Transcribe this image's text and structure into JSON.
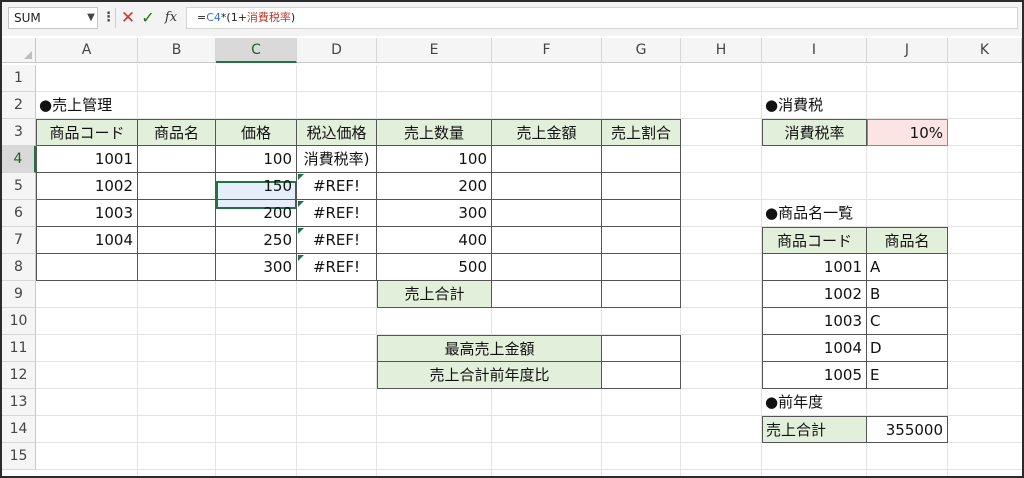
{
  "formula_bar": {
    "name_box": "SUM",
    "formula_prefix": "=",
    "formula_ref": "C4",
    "formula_mid": "*(1+",
    "formula_name": "消費税率",
    "formula_suffix": ")"
  },
  "columns": [
    "A",
    "B",
    "C",
    "D",
    "E",
    "F",
    "G",
    "H",
    "I",
    "J",
    "K"
  ],
  "rows": [
    "1",
    "2",
    "3",
    "4",
    "5",
    "6",
    "7",
    "8",
    "9",
    "10",
    "11",
    "12",
    "13",
    "14",
    "15"
  ],
  "sales": {
    "title": "●売上管理",
    "headers": [
      "商品コード",
      "商品名",
      "価格",
      "税込価格",
      "売上数量",
      "売上金額",
      "売上割合"
    ],
    "rows": [
      {
        "code": "1001",
        "price": "100",
        "tax_price": "消費税率)",
        "qty": "100"
      },
      {
        "code": "1002",
        "price": "150",
        "tax_price": "#REF!",
        "qty": "200"
      },
      {
        "code": "1003",
        "price": "200",
        "tax_price": "#REF!",
        "qty": "300"
      },
      {
        "code": "1004",
        "price": "250",
        "tax_price": "#REF!",
        "qty": "400"
      },
      {
        "code": "",
        "price": "300",
        "tax_price": "#REF!",
        "qty": "500"
      }
    ],
    "total_label": "売上合計",
    "max_label": "最高売上金額",
    "yoy_label": "売上合計前年度比"
  },
  "tax": {
    "title": "●消費税",
    "label": "消費税率",
    "value": "10%"
  },
  "products": {
    "title": "●商品名一覧",
    "headers": [
      "商品コード",
      "商品名"
    ],
    "rows": [
      {
        "code": "1001",
        "name": "A"
      },
      {
        "code": "1002",
        "name": "B"
      },
      {
        "code": "1003",
        "name": "C"
      },
      {
        "code": "1004",
        "name": "D"
      },
      {
        "code": "1005",
        "name": "E"
      }
    ]
  },
  "prev_year": {
    "title": "●前年度",
    "label": "売上合計",
    "value": "355000"
  },
  "colors": {
    "header_fill": "#e2efda",
    "selection": "#217346",
    "tax_fill": "#fde4e4"
  }
}
